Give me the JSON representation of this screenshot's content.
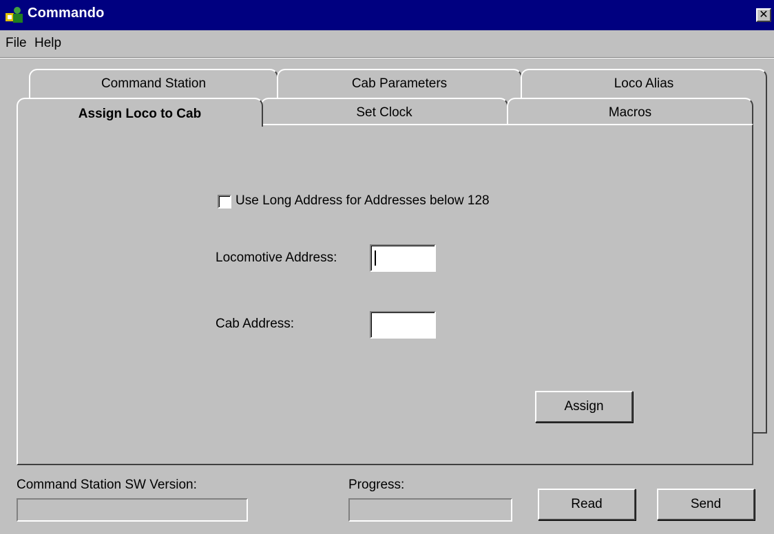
{
  "window": {
    "title": "Commando",
    "app_icon": "commando-app-icon",
    "close_glyph": "✕"
  },
  "menu": {
    "file": "File",
    "help": "Help"
  },
  "tabs": {
    "back_row": [
      "Command Station",
      "Cab Parameters",
      "Loco Alias"
    ],
    "front_row": [
      "Assign Loco to Cab",
      "Set Clock",
      "Macros"
    ],
    "active": "Assign Loco to Cab"
  },
  "assign_panel": {
    "checkbox_label": "Use Long Address for Addresses below 128",
    "checkbox_checked": false,
    "loco_address_label": "Locomotive Address:",
    "loco_address_value": "",
    "cab_address_label": "Cab Address:",
    "cab_address_value": "",
    "assign_button": "Assign"
  },
  "status": {
    "sw_version_label": "Command Station SW Version:",
    "sw_version_value": "",
    "progress_label": "Progress:",
    "progress_value": ""
  },
  "buttons": {
    "read": "Read",
    "send": "Send"
  },
  "colors": {
    "titlebar": "#000080",
    "face": "#c0c0c0"
  }
}
